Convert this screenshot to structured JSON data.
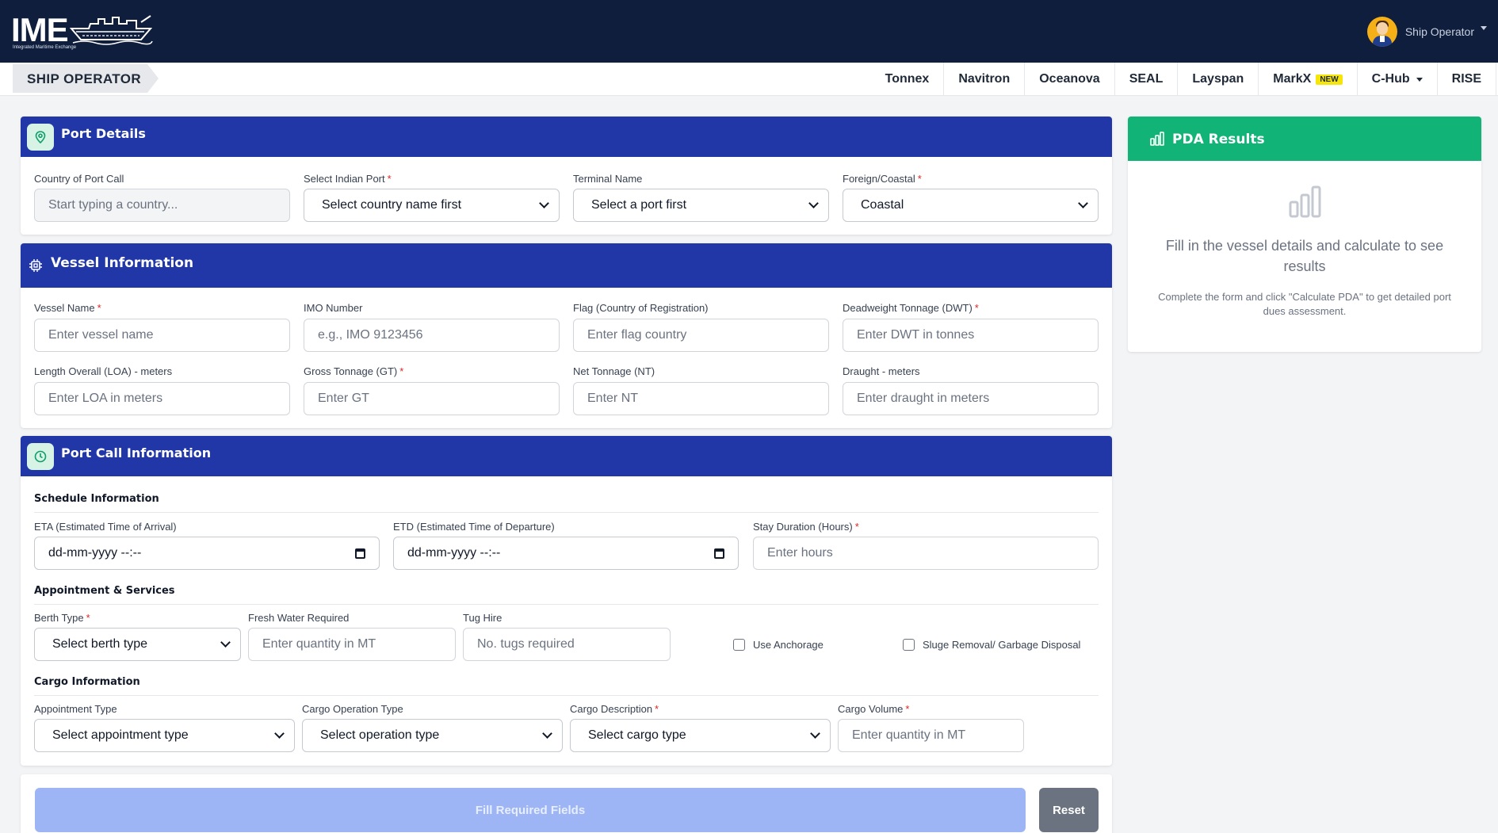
{
  "app": {
    "logo_text": "IME",
    "logo_subtitle": "Integrated Maritime Exchange",
    "user_name": "Ship Operator"
  },
  "nav": {
    "role": "SHIP OPERATOR",
    "items": [
      "Tonnex",
      "Navitron",
      "Oceanova",
      "SEAL",
      "Layspan",
      "MarkX",
      "C-Hub",
      "RISE"
    ],
    "new_badge": "NEW"
  },
  "port_details": {
    "title": "Port Details",
    "country_label": "Country of Port Call",
    "country_placeholder": "Start typing a country...",
    "port_label": "Select Indian Port",
    "port_value": "Select country name first",
    "terminal_label": "Terminal Name",
    "terminal_value": "Select a port first",
    "foreign_label": "Foreign/Coastal",
    "foreign_value": "Coastal"
  },
  "vessel": {
    "title": "Vessel Information",
    "name_label": "Vessel Name",
    "name_placeholder": "Enter vessel name",
    "imo_label": "IMO Number",
    "imo_placeholder": "e.g., IMO 9123456",
    "flag_label": "Flag (Country of Registration)",
    "flag_placeholder": "Enter flag country",
    "dwt_label": "Deadweight Tonnage (DWT)",
    "dwt_placeholder": "Enter DWT in tonnes",
    "loa_label": "Length Overall (LOA) - meters",
    "loa_placeholder": "Enter LOA in meters",
    "gt_label": "Gross Tonnage (GT)",
    "gt_placeholder": "Enter GT",
    "nt_label": "Net Tonnage (NT)",
    "nt_placeholder": "Enter NT",
    "draught_label": "Draught - meters",
    "draught_placeholder": "Enter draught in meters"
  },
  "port_call": {
    "title": "Port Call Information",
    "schedule_title": "Schedule Information",
    "eta_label": "ETA (Estimated Time of Arrival)",
    "eta_value": "dd-mm-yyyy --:--",
    "etd_label": "ETD (Estimated Time of Departure)",
    "etd_value": "dd-mm-yyyy --:--",
    "stay_label": "Stay Duration (Hours)",
    "stay_placeholder": "Enter hours",
    "services_title": "Appointment & Services",
    "berth_label": "Berth Type",
    "berth_value": "Select berth type",
    "water_label": "Fresh Water Required",
    "water_placeholder": "Enter quantity in MT",
    "tug_label": "Tug Hire",
    "tug_placeholder": "No. tugs required",
    "anchorage_label": "Use Anchorage",
    "sludge_label": "Sluge Removal/ Garbage Disposal",
    "cargo_title": "Cargo Information",
    "appointment_label": "Appointment Type",
    "appointment_value": "Select appointment type",
    "operation_label": "Cargo Operation Type",
    "operation_value": "Select operation type",
    "description_label": "Cargo Description",
    "description_value": "Select cargo type",
    "volume_label": "Cargo Volume",
    "volume_placeholder": "Enter quantity in MT"
  },
  "actions": {
    "submit_label": "Fill Required Fields",
    "reset_label": "Reset"
  },
  "pda": {
    "title": "PDA Results",
    "message": "Fill in the vessel details and calculate to see results",
    "hint": "Complete the form and click \"Calculate PDA\" to get detailed port dues assessment."
  },
  "colors": {
    "topbar": "#0f1e3d",
    "section_header": "#2137a8",
    "pda_header": "#12b377",
    "submit_disabled": "#9db5f5",
    "reset": "#6b7280",
    "required": "#dc2626"
  }
}
